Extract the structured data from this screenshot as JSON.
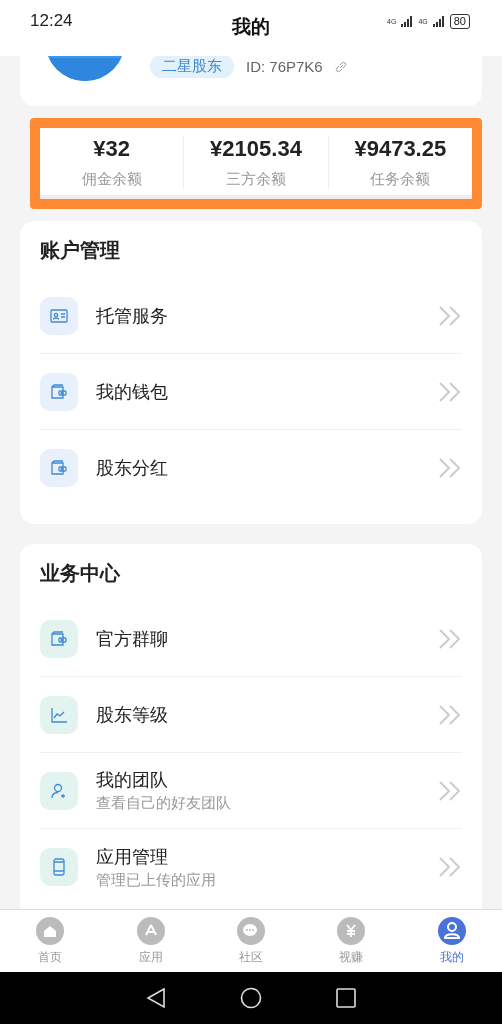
{
  "status_bar": {
    "time": "12:24",
    "network_1": "4G",
    "network_2": "4G",
    "battery": "80"
  },
  "header": {
    "title": "我的"
  },
  "profile": {
    "badge": "二星股东",
    "id": "ID: 76P7K6"
  },
  "balances": [
    {
      "amount": "¥32",
      "label": "佣金余额"
    },
    {
      "amount": "¥2105.34",
      "label": "三方余额"
    },
    {
      "amount": "¥9473.25",
      "label": "任务余额"
    }
  ],
  "sections": [
    {
      "title": "账户管理",
      "color": "#e8f0fc",
      "items": [
        {
          "kind": "card",
          "label": "托管服务"
        },
        {
          "kind": "wallet",
          "label": "我的钱包"
        },
        {
          "kind": "wallet",
          "label": "股东分红"
        }
      ]
    },
    {
      "title": "业务中心",
      "color": "#e3f4f0",
      "items": [
        {
          "kind": "wallet",
          "label": "官方群聊"
        },
        {
          "kind": "chart",
          "label": "股东等级"
        },
        {
          "kind": "user",
          "label": "我的团队",
          "sub": "查看自己的好友团队"
        },
        {
          "kind": "phone",
          "label": "应用管理",
          "sub": "管理已上传的应用"
        }
      ]
    }
  ],
  "tabs": [
    {
      "kind": "home",
      "label": "首页",
      "selected": false
    },
    {
      "kind": "apps",
      "label": "应用",
      "selected": false
    },
    {
      "kind": "chat",
      "label": "社区",
      "selected": false
    },
    {
      "kind": "yen",
      "label": "视赚",
      "selected": false
    },
    {
      "kind": "person",
      "label": "我的",
      "selected": true
    }
  ]
}
